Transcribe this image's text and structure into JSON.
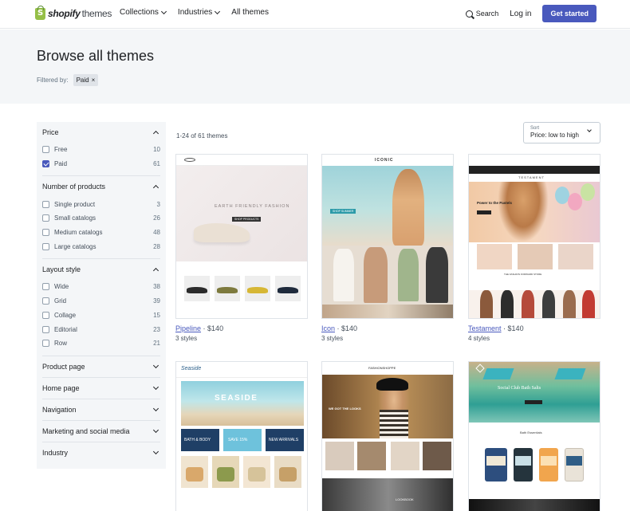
{
  "nav": {
    "logo_brand": "shopify",
    "logo_suffix": "themes",
    "links": [
      "Collections",
      "Industries",
      "All themes"
    ],
    "search": "Search",
    "login": "Log in",
    "cta": "Get started"
  },
  "hero": {
    "title": "Browse all themes",
    "filtered_by": "Filtered by:",
    "chip": "Paid",
    "chip_remove": "×"
  },
  "filters": {
    "price": {
      "title": "Price",
      "options": [
        {
          "label": "Free",
          "count": "10",
          "checked": false
        },
        {
          "label": "Paid",
          "count": "61",
          "checked": true
        }
      ]
    },
    "products": {
      "title": "Number of products",
      "options": [
        {
          "label": "Single product",
          "count": "3"
        },
        {
          "label": "Small catalogs",
          "count": "26"
        },
        {
          "label": "Medium catalogs",
          "count": "48"
        },
        {
          "label": "Large catalogs",
          "count": "28"
        }
      ]
    },
    "layout": {
      "title": "Layout style",
      "options": [
        {
          "label": "Wide",
          "count": "38"
        },
        {
          "label": "Grid",
          "count": "39"
        },
        {
          "label": "Collage",
          "count": "15"
        },
        {
          "label": "Editorial",
          "count": "23"
        },
        {
          "label": "Row",
          "count": "21"
        }
      ]
    },
    "collapsed": [
      "Product page",
      "Home page",
      "Navigation",
      "Marketing and social media",
      "Industry"
    ]
  },
  "results": {
    "count": "1-24 of 61 themes",
    "sort_label": "Sort",
    "sort_value": "Price: low to high"
  },
  "themes": [
    {
      "name": "Pipeline",
      "price": "$140",
      "styles": "3 styles",
      "preview": {
        "headline": "EARTH FRIENDLY FASHION",
        "button": "SHOP PRODUCTS"
      }
    },
    {
      "name": "Icon",
      "price": "$140",
      "styles": "3 styles",
      "preview": {
        "logo": "ICONIC",
        "button": "SHOP SUMMER"
      }
    },
    {
      "name": "Testament",
      "price": "$140",
      "styles": "4 styles",
      "preview": {
        "logo": "TESTAMENT",
        "headline": "Power to the Pastels",
        "store": "THE FASHION FORWARD STORE"
      }
    },
    {
      "name": "",
      "price": "",
      "styles": "",
      "preview": {
        "logo": "Seaside",
        "headline": "SEASIDE",
        "tiles": [
          "BATH & BODY",
          "SAVE 15%",
          "NEW ARRIVALS"
        ]
      }
    },
    {
      "name": "",
      "price": "",
      "styles": "",
      "preview": {
        "logo": "FASHIONSHOPPE",
        "headline": "WE GOT THE LOOKS",
        "caption": "LOOKBOOK"
      }
    },
    {
      "name": "",
      "price": "",
      "styles": "",
      "preview": {
        "headline": "Social Club Bath Salts",
        "section": "Bath Essentials"
      }
    }
  ],
  "colors": {
    "accent": "#4959bd",
    "hero_bg": "#f4f6f8",
    "link": "#4959bd",
    "brand_green": "#95bf47"
  }
}
